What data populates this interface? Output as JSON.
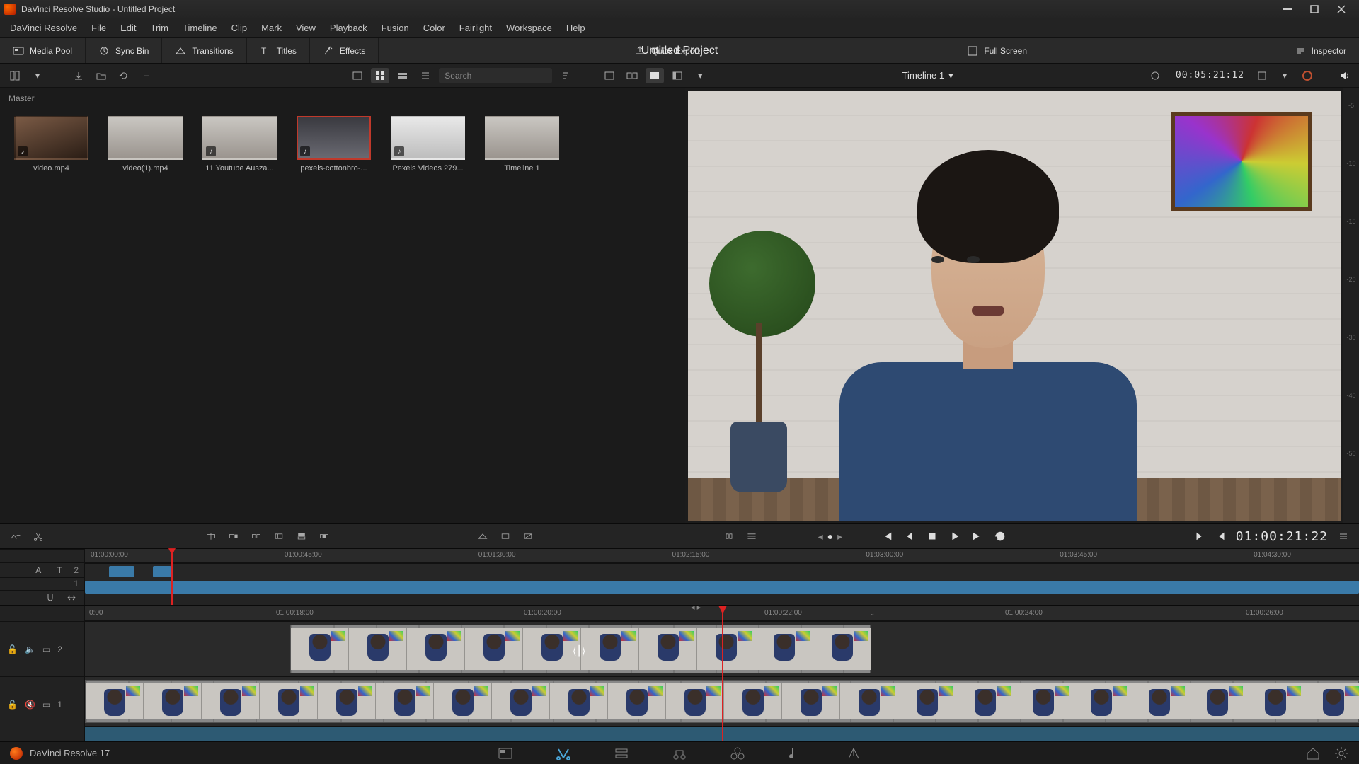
{
  "window_title": "DaVinci Resolve Studio - Untitled Project",
  "menus": [
    "DaVinci Resolve",
    "File",
    "Edit",
    "Trim",
    "Timeline",
    "Clip",
    "Mark",
    "View",
    "Playback",
    "Fusion",
    "Color",
    "Fairlight",
    "Workspace",
    "Help"
  ],
  "toolstrip": {
    "media_pool": "Media Pool",
    "sync_bin": "Sync Bin",
    "transitions": "Transitions",
    "titles": "Titles",
    "effects": "Effects",
    "project_title": "Untitled Project",
    "quick_export": "Quick Export",
    "full_screen": "Full Screen",
    "inspector": "Inspector"
  },
  "sec_strip": {
    "search_placeholder": "Search",
    "timeline_name": "Timeline 1",
    "source_timecode": "00:05:21:12"
  },
  "media_pool": {
    "bin": "Master",
    "clips": [
      {
        "label": "video.mp4",
        "audio": true
      },
      {
        "label": "video(1).mp4",
        "audio": false
      },
      {
        "label": "11 Youtube Ausza...",
        "audio": true
      },
      {
        "label": "pexels-cottonbro-...",
        "audio": true,
        "selected": true
      },
      {
        "label": "Pexels Videos 279...",
        "audio": true
      },
      {
        "label": "Timeline 1",
        "audio": false
      }
    ]
  },
  "meter_marks": [
    "-5",
    "-10",
    "-15",
    "-20",
    "-30",
    "-40",
    "-50"
  ],
  "transport": {
    "timecode": "01:00:21:22"
  },
  "upper_ruler": [
    "01:00:00:00",
    "01:00:45:00",
    "01:01:30:00",
    "01:02:15:00",
    "01:03:00:00",
    "01:03:45:00",
    "01:04:30:00"
  ],
  "lower_ruler": [
    "0:00",
    "01:00:18:00",
    "01:00:20:00",
    "01:00:22:00",
    "01:00:24:00",
    "01:00:26:00"
  ],
  "tracks": {
    "v2": "2",
    "v1": "1",
    "a1": "1"
  },
  "footer": {
    "brand": "DaVinci Resolve 17"
  }
}
